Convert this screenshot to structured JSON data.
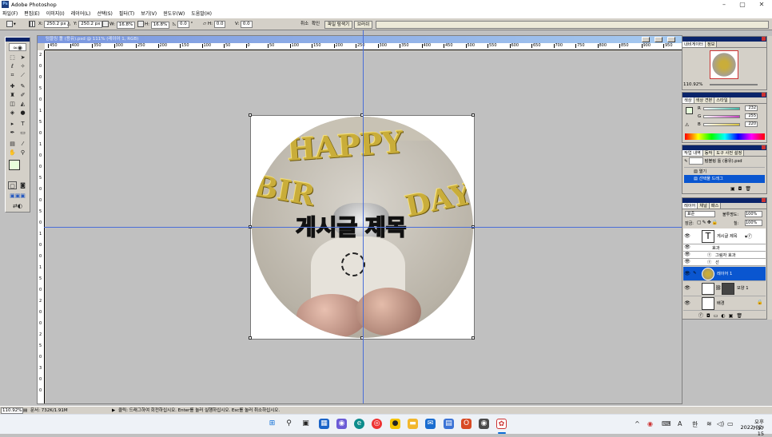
{
  "app": {
    "title": "Adobe Photoshop",
    "logo_text": "Ps"
  },
  "window_controls": {
    "minimize": "–",
    "maximize": "▢",
    "close": "✕"
  },
  "menus": [
    "파일(F)",
    "편집(E)",
    "이미지(I)",
    "레이어(L)",
    "선택(S)",
    "필터(T)",
    "보기(V)",
    "윈도우(W)",
    "도움말(H)"
  ],
  "options": {
    "x_label": "X:",
    "x_value": "250.2 px",
    "y_label": "Y:",
    "y_value": "250.2 px",
    "w_label": "W:",
    "w_value": "16.8%",
    "h_label": "H:",
    "h_value": "16.8%",
    "angle_value": "0.0",
    "skew_label": "°",
    "hskew_label": "H:",
    "hskew_value": "0.0",
    "vskew_label": "V:",
    "vskew_value": "0.0",
    "cancel": "취소",
    "commit": "확인",
    "palette_tabs": [
      "파일 탐색기",
      "브러쉬"
    ]
  },
  "document": {
    "title": "텀블링 툴 (용유).psd @ 111% (레이어 1, RGB)",
    "h_ruler": [
      "450",
      "400",
      "350",
      "300",
      "250",
      "200",
      "150",
      "100",
      "50",
      "0",
      "50",
      "100",
      "150",
      "200",
      "250",
      "300",
      "350",
      "400",
      "450",
      "500",
      "550",
      "600",
      "650",
      "700",
      "750",
      "800",
      "850",
      "900",
      "950"
    ],
    "v_ruler": [
      "2",
      "0",
      "0",
      "5",
      "0",
      "1",
      "5",
      "0",
      "1",
      "0",
      "0",
      "5",
      "0",
      "0",
      "5",
      "0",
      "1",
      "0",
      "0",
      "1",
      "5",
      "0",
      "2",
      "0",
      "0",
      "2",
      "5",
      "0",
      "3",
      "0",
      "0"
    ],
    "overlay_text": "게시글 제목",
    "balloon_top": "HAPPY",
    "balloon_bottom": [
      "BIR",
      "DAY"
    ]
  },
  "navigator": {
    "tabs": [
      "내비게이터",
      "정보"
    ],
    "zoom": "110.92%"
  },
  "color": {
    "tabs": [
      "색상",
      "색상 견본",
      "스타일"
    ],
    "channels": [
      {
        "label": "R",
        "value": "232",
        "color": "#3fb7a6"
      },
      {
        "label": "G",
        "value": "255",
        "color": "#c43fbf"
      },
      {
        "label": "B",
        "value": "220",
        "color": "#d7c13c"
      }
    ],
    "foreground": "#e8ffdc"
  },
  "history": {
    "tabs": [
      "작업 내역",
      "동작",
      "도구 사전 설정"
    ],
    "items": [
      "텀블링 툴 (용유).psd",
      "열기",
      "선택물 드래그"
    ]
  },
  "layers": {
    "tabs": [
      "레이어",
      "채널",
      "패스"
    ],
    "blend_mode": "표준",
    "opacity_label": "불투명도:",
    "opacity": "100%",
    "lock_label": "잠금:",
    "fill_label": "칠:",
    "fill": "100%",
    "rows": [
      {
        "name": "게시글 제목",
        "type": "text"
      },
      {
        "name": "효과",
        "type": "effect-group"
      },
      {
        "name": "그림자 효과",
        "type": "effect"
      },
      {
        "name": "선",
        "type": "effect"
      },
      {
        "name": "레이어 1",
        "type": "image",
        "selected": true
      },
      {
        "name": "모양 1",
        "type": "shape"
      },
      {
        "name": "배경",
        "type": "background"
      }
    ]
  },
  "status": {
    "zoom": "110.92%",
    "doc_size": "문서: 732K/1.91M",
    "hint": "클릭: 드래그하여 회전하십시오. Enter를 눌러 실행하십시오. Esc를 눌러 취소하십시오."
  },
  "tray": {
    "chevron": "^",
    "ime": "A",
    "lang": "한",
    "time": "오후 7:37",
    "date": "2022-02-15"
  }
}
